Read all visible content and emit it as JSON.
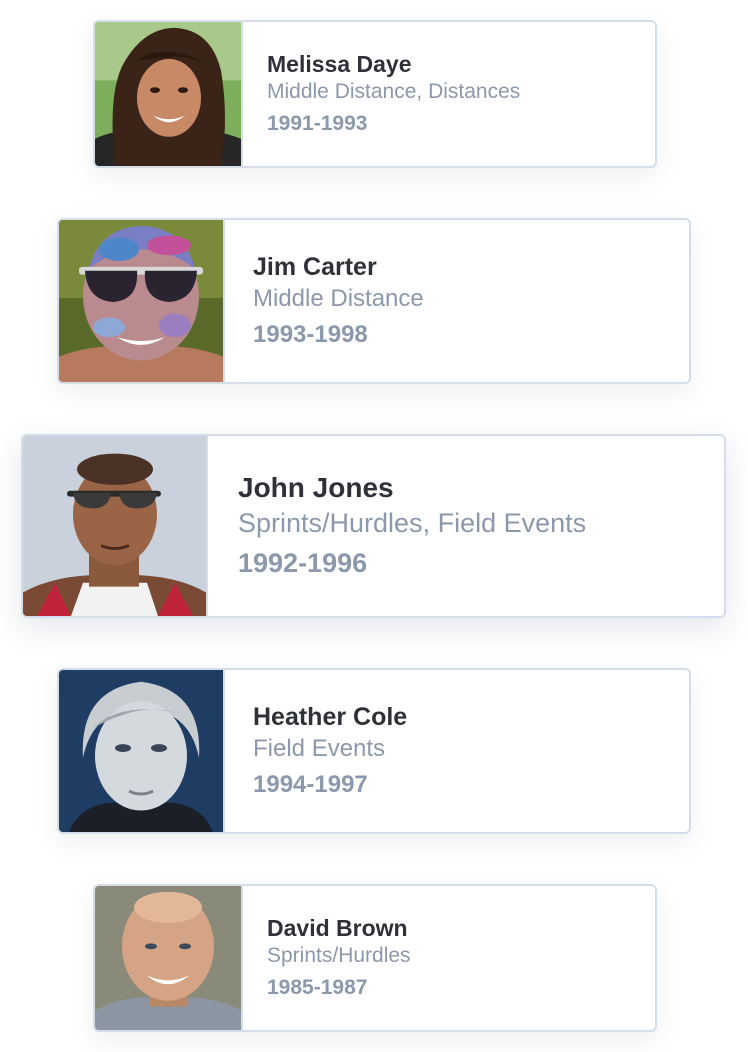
{
  "athletes": [
    {
      "name": "Melissa Daye",
      "discipline": "Middle Distance, Distances",
      "years": "1991-1993",
      "photo": "woman-dark-hair-portrait"
    },
    {
      "name": "Jim Carter",
      "discipline": "Middle Distance",
      "years": "1993-1998",
      "photo": "man-sunglasses-color-powder-portrait"
    },
    {
      "name": "John Jones",
      "discipline": "Sprints/Hurdles, Field Events",
      "years": "1992-1996",
      "photo": "man-sunglasses-tank-top-portrait"
    },
    {
      "name": "Heather Cole",
      "discipline": "Field Events",
      "years": "1994-1997",
      "photo": "woman-blonde-portrait"
    },
    {
      "name": "David Brown",
      "discipline": "Sprints/Hurdles",
      "years": "1985-1987",
      "photo": "bald-man-smiling-portrait"
    }
  ],
  "colors": {
    "card_border": "#d5dde9",
    "name_text": "#2e3238",
    "meta_text": "#8c98ab"
  }
}
